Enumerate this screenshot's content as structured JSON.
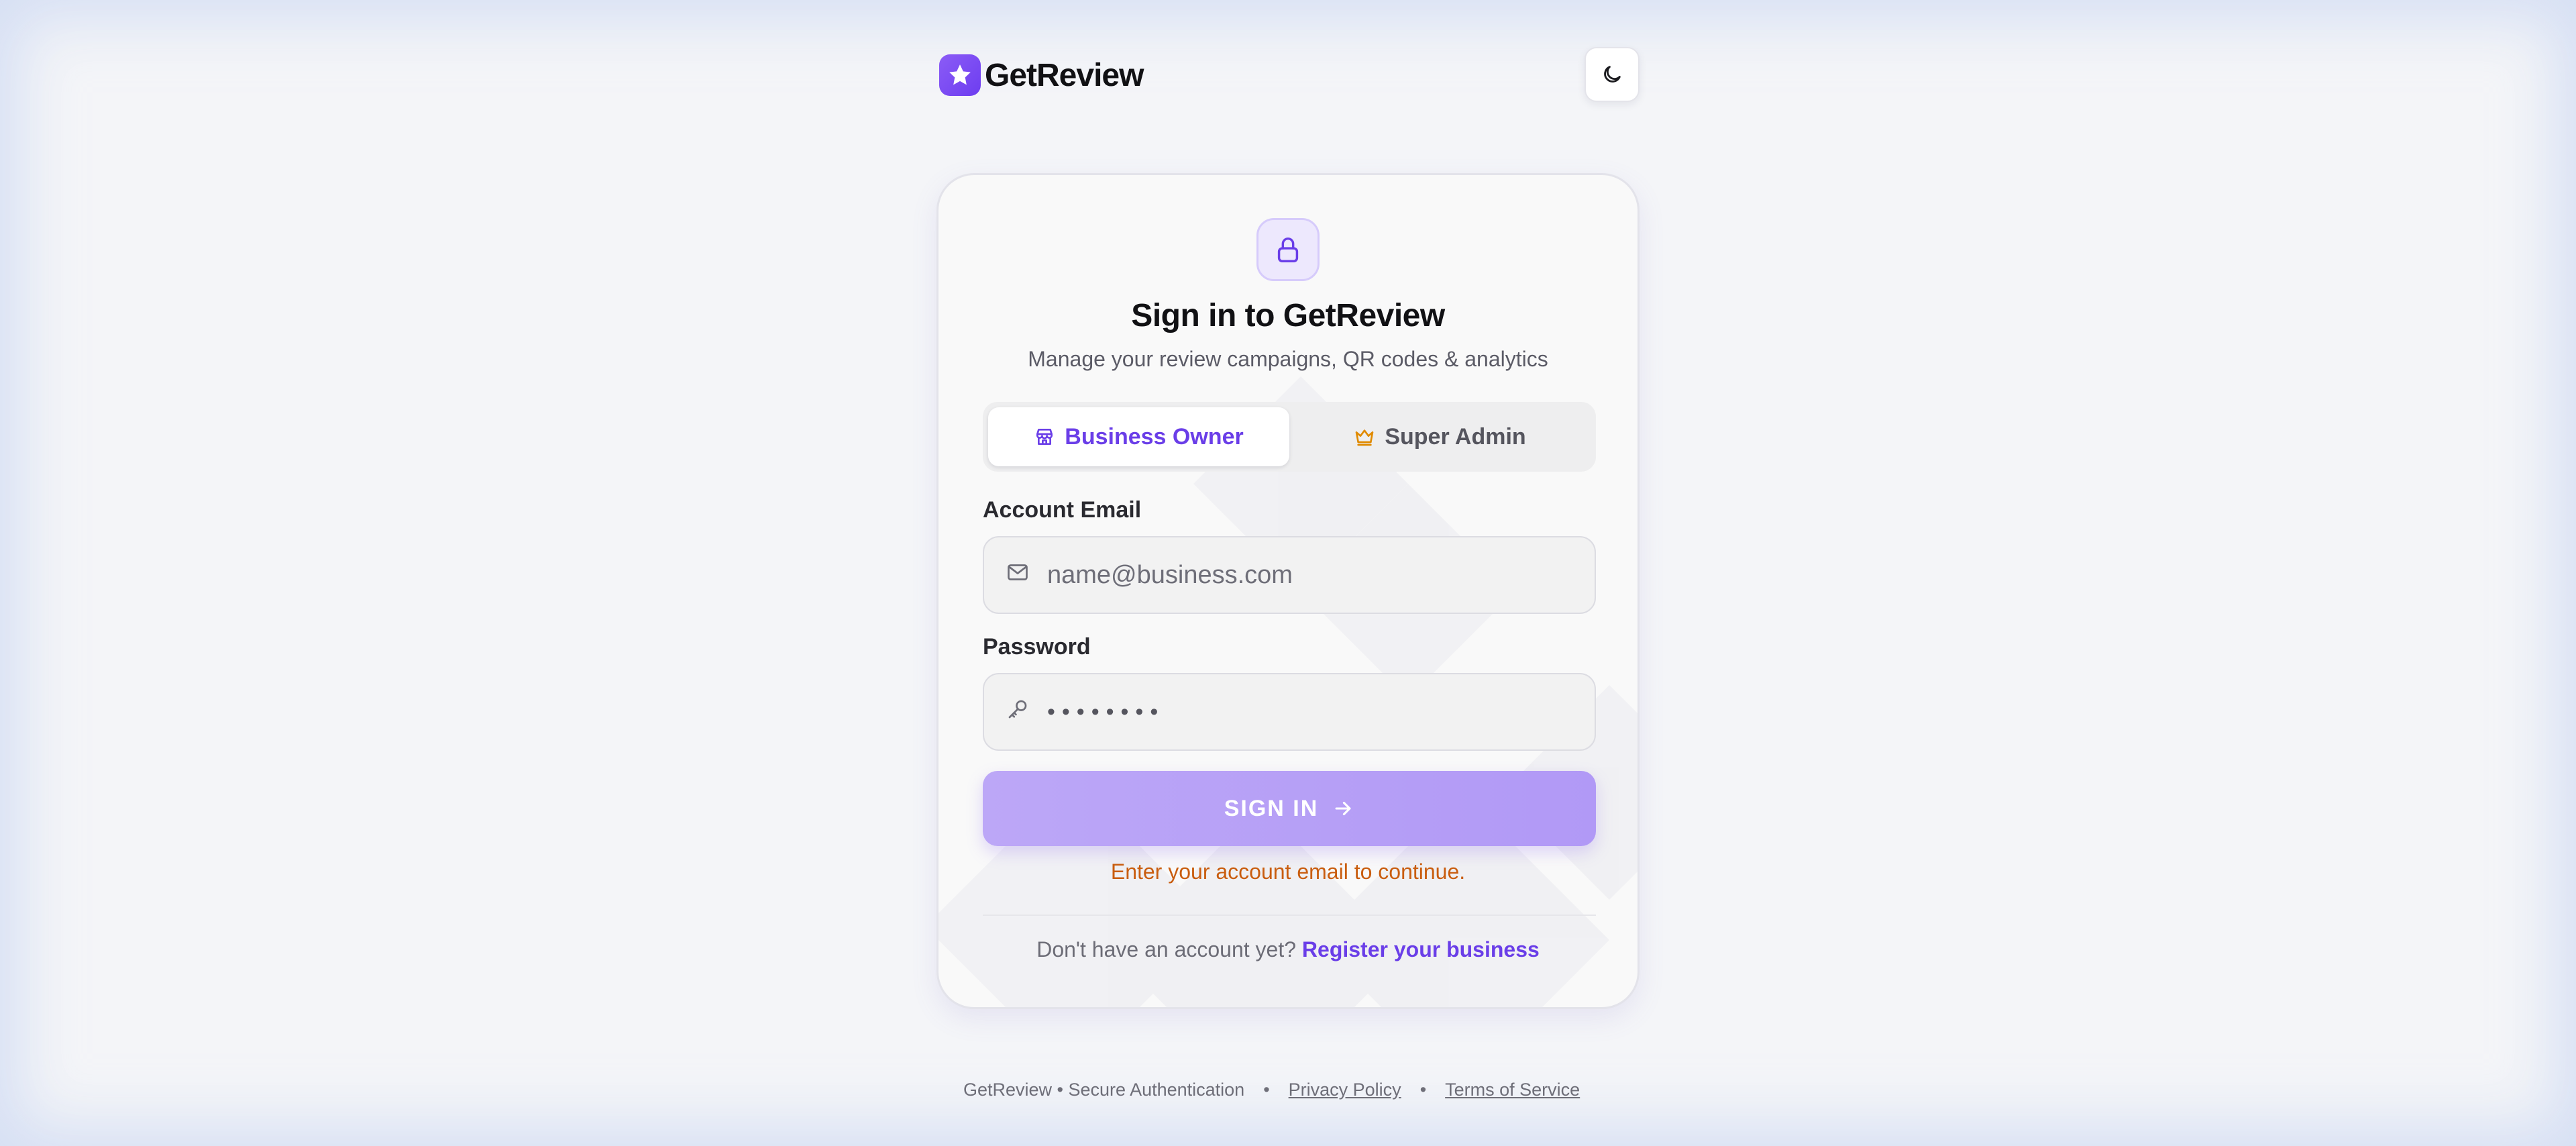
{
  "brand": {
    "name": "GetReview",
    "logo_icon": "star-icon",
    "accent_color": "#7c4dff"
  },
  "header": {
    "theme_toggle_icon": "moon-icon"
  },
  "card": {
    "icon": "lock-icon",
    "title": "Sign in to GetReview",
    "subtitle": "Manage your review campaigns, QR codes & analytics",
    "roles": [
      {
        "label": "Business Owner",
        "icon": "store-icon",
        "selected": true
      },
      {
        "label": "Super Admin",
        "icon": "crown-icon",
        "selected": false
      }
    ],
    "email": {
      "label": "Account Email",
      "icon": "mail-icon",
      "placeholder": "name@business.com",
      "value": ""
    },
    "password": {
      "label": "Password",
      "icon": "key-icon",
      "masked_value": "••••••••"
    },
    "submit": {
      "label": "SIGN IN",
      "icon": "arrow-right-icon"
    },
    "error_message": "Enter your account email to continue.",
    "register": {
      "prompt": "Don't have an account yet?",
      "link_label": "Register your business"
    }
  },
  "footer": {
    "tagline": "GetReview • Secure Authentication",
    "separator": "•",
    "links": [
      "Privacy Policy",
      "Terms of Service"
    ]
  },
  "colors": {
    "accent": "#6a3ee8",
    "button": "#b9a3f7",
    "error": "#c95d0f",
    "crown": "#e08a00"
  }
}
